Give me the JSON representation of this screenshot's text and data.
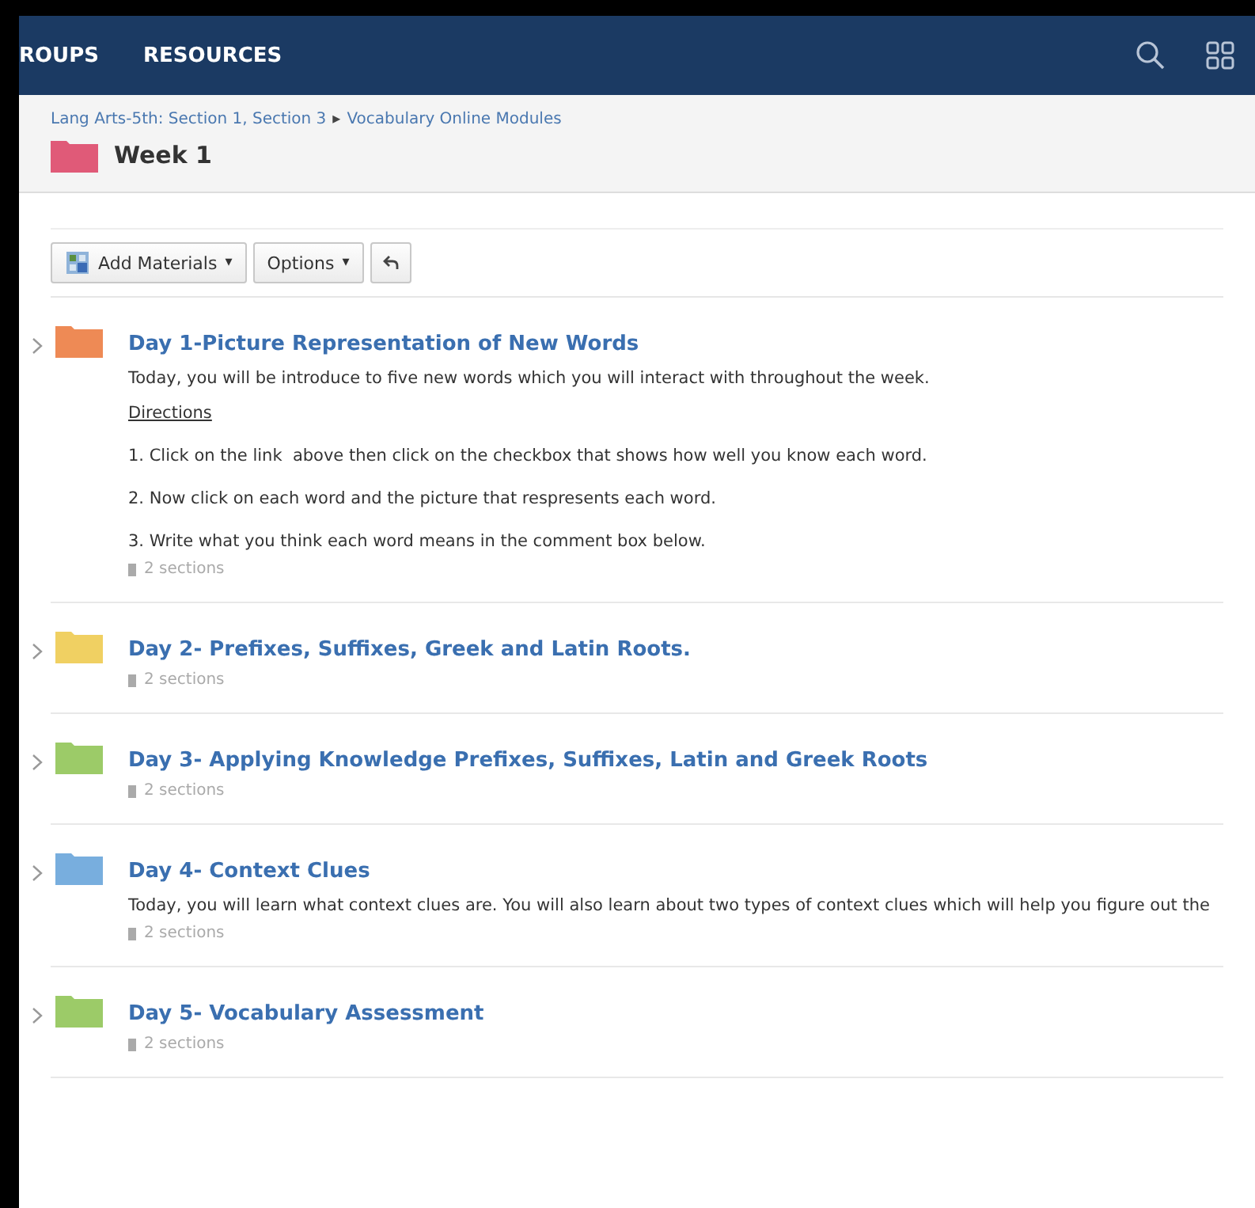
{
  "nav": {
    "items": [
      "ROUPS",
      "RESOURCES"
    ]
  },
  "header": {
    "breadcrumb": [
      "Lang Arts-5th: Section 1, Section 3",
      "Vocabulary Online Modules"
    ],
    "breadcrumb_separator": "▸",
    "title": "Week 1",
    "color": "#e05a78"
  },
  "toolbar": {
    "buttons": [
      {
        "label": "Add Materials",
        "caret": "▾",
        "kind": "add"
      },
      {
        "label": "Options",
        "caret": "▾",
        "kind": "plain"
      },
      {
        "kind": "undo"
      }
    ]
  },
  "folders": [
    {
      "title": "Day 1-Picture Representation of New Words",
      "color": "#ee8a55",
      "description": "Today, you will be introduce to five new words which you will interact with throughout the week.",
      "directions_heading": "Directions",
      "directions": [
        "1. Click on the link  above then click on the checkbox that shows how well you know each word.",
        "2. Now click on each word and the picture that respresents each word.",
        "3. Write what you think each word means in the comment box below."
      ],
      "sections": "2 sections"
    },
    {
      "title": "Day 2- Prefixes, Suffixes, Greek and Latin Roots.",
      "color": "#f0d062",
      "sections": "2 sections"
    },
    {
      "title": "Day 3- Applying Knowledge Prefixes, Suffixes, Latin and Greek Roots",
      "color": "#9ccb68",
      "sections": "2 sections"
    },
    {
      "title": "Day 4- Context Clues",
      "color": "#78aede",
      "description": "Today, you will learn what context clues are. You will also learn about two types of context clues which will help you figure out the",
      "sections": "2 sections"
    },
    {
      "title": "Day 5- Vocabulary Assessment",
      "color": "#9ccb68",
      "sections": "2 sections"
    }
  ]
}
